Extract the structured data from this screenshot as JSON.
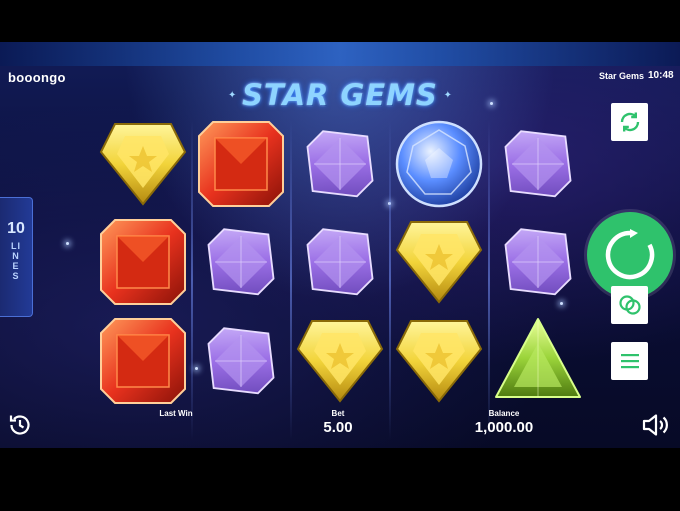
{
  "header": {
    "brand": "booongo",
    "game_name": "Star Gems",
    "clock": "10:48",
    "tabs": [
      {
        "icon": "monitor-icon"
      },
      {
        "icon": "globe-icon"
      },
      {
        "icon": "star-icon"
      }
    ]
  },
  "logo": {
    "title": "STAR GEMS"
  },
  "lines": {
    "count": "10",
    "label": "LINES"
  },
  "reels": {
    "columns": [
      [
        "yellow-shield-gem",
        "red-square-gem",
        "red-square-gem"
      ],
      [
        "red-square-gem",
        "purple-diamond-gem",
        "purple-diamond-gem"
      ],
      [
        "purple-diamond-gem",
        "purple-diamond-gem",
        "yellow-shield-gem"
      ],
      [
        "blue-round-gem",
        "yellow-shield-gem",
        "yellow-shield-gem"
      ],
      [
        "purple-diamond-gem",
        "purple-diamond-gem",
        "green-triangle-gem"
      ]
    ]
  },
  "controls": {
    "autoplay_icon": "refresh-icon",
    "spin_icon": "spin-icon",
    "bet_icon": "coins-icon",
    "menu_icon": "menu-icon",
    "history_icon": "history-icon",
    "sound_icon": "speaker-icon"
  },
  "footer": {
    "last_win_label": "Last Win",
    "bet_label": "Bet",
    "bet_value": "5.00",
    "balance_label": "Balance",
    "balance_value": "1,000.00"
  },
  "colors": {
    "spin_green": "#2fc26c",
    "gem_yellow": "#f2d43a",
    "gem_red": "#e8321e",
    "gem_purple": "#9b6fe6",
    "gem_blue": "#5a8dff",
    "gem_green": "#9bd43a"
  }
}
